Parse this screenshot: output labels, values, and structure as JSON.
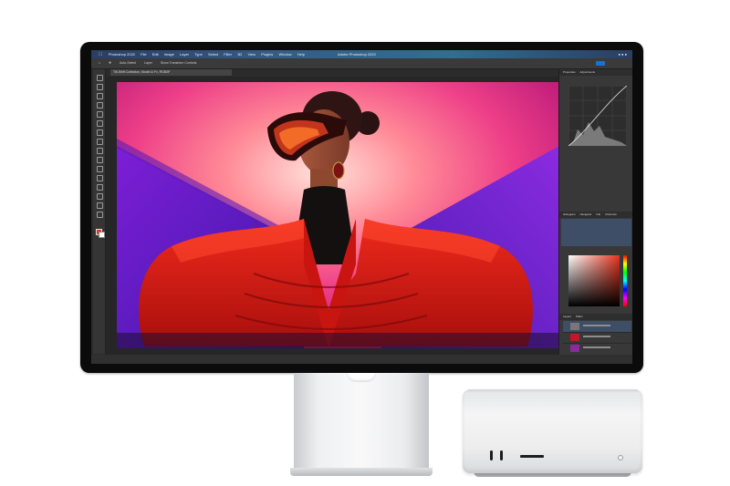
{
  "screen": {
    "menubar": {
      "app_name": "Photoshop 2022",
      "items": [
        "File",
        "Edit",
        "Image",
        "Layer",
        "Type",
        "Select",
        "Filter",
        "3D",
        "View",
        "Plugins",
        "Window",
        "Help"
      ],
      "window_title": "Adobe Photoshop 2022"
    },
    "options_bar": {
      "items": [
        "Auto-Select",
        "Layer",
        "Show Transform Controls"
      ]
    },
    "doc_tab": {
      "label": "Tilt-Shift Collection, Model & Fx, RGB/8*"
    },
    "panels": {
      "top_tabs": [
        "Properties",
        "Adjustments"
      ],
      "channels_tabs": [
        "Histogram",
        "Navigator",
        "Info",
        "Channels"
      ],
      "layers_tabs": [
        "Layers",
        "Paths"
      ]
    },
    "colors": {
      "foreground": "#e5331f",
      "background": "#ffffff"
    },
    "icons": [
      "apple-icon",
      "move-tool-icon",
      "marquee-tool-icon",
      "lasso-tool-icon",
      "crop-tool-icon",
      "brush-tool-icon",
      "eraser-tool-icon",
      "gradient-tool-icon",
      "text-tool-icon",
      "pen-tool-icon",
      "hand-tool-icon",
      "zoom-tool-icon"
    ]
  },
  "hardware": {
    "display": "studio-display",
    "computer": "mac-studio",
    "ports": [
      "usb-c-port",
      "usb-c-port",
      "sd-card-slot",
      "power-indicator"
    ]
  }
}
